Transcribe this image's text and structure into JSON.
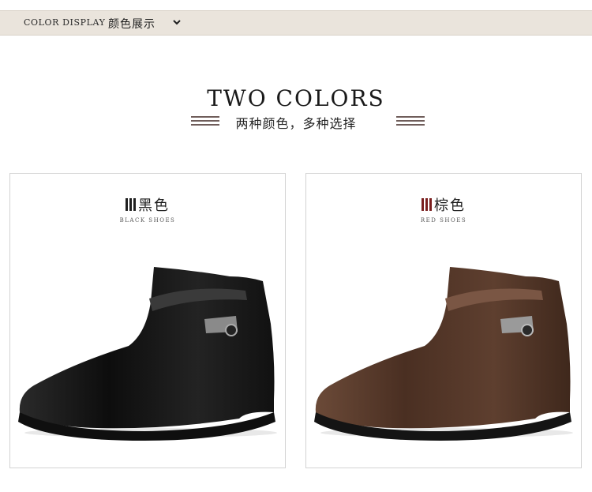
{
  "header": {
    "english_label": "COLOR DISPLAY",
    "chinese_label": "颜色展示"
  },
  "section": {
    "title": "TWO COLORS",
    "subtitle": "两种颜色，多种选择"
  },
  "products": [
    {
      "color_name": "黑色",
      "caption": "BLACK SHOES",
      "accent": "#1f1f1f",
      "boot_color": "#1b1b1b"
    },
    {
      "color_name": "棕色",
      "caption": "RED SHOES",
      "accent": "#7a1e1e",
      "boot_color": "#5a3a2a"
    }
  ]
}
